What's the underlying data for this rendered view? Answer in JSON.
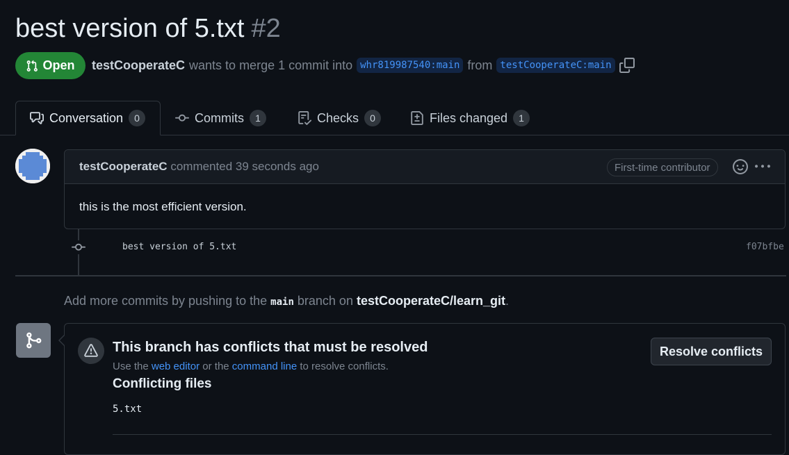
{
  "pr": {
    "title": "best version of 5.txt",
    "number": "#2",
    "status": "Open",
    "author": "testCooperateC",
    "merge_text": "wants to merge 1 commit into",
    "base_branch": "whr819987540:main",
    "from_text": "from",
    "head_branch": "testCooperateC:main"
  },
  "tabs": [
    {
      "label": "Conversation",
      "count": "0"
    },
    {
      "label": "Commits",
      "count": "1"
    },
    {
      "label": "Checks",
      "count": "0"
    },
    {
      "label": "Files changed",
      "count": "1"
    }
  ],
  "comment": {
    "author": "testCooperateC",
    "action": "commented",
    "time": "39 seconds ago",
    "badge": "First-time contributor",
    "body": "this is the most efficient version."
  },
  "commit": {
    "message": "best version of 5.txt",
    "sha": "f07bfbe"
  },
  "push_hint": {
    "prefix": "Add more commits by pushing to the",
    "branch": "main",
    "middle": "branch on",
    "repo": "testCooperateC/learn_git",
    "suffix": "."
  },
  "merge": {
    "title": "This branch has conflicts that must be resolved",
    "desc_prefix": "Use the",
    "web_editor": "web editor",
    "desc_middle": "or the",
    "command_line": "command line",
    "desc_suffix": "to resolve conflicts.",
    "conflicting_title": "Conflicting files",
    "files": [
      "5.txt"
    ],
    "resolve_label": "Resolve conflicts"
  },
  "colors": {
    "open_green": "#238636",
    "link_blue": "#4493f8",
    "background": "#0d1117"
  }
}
